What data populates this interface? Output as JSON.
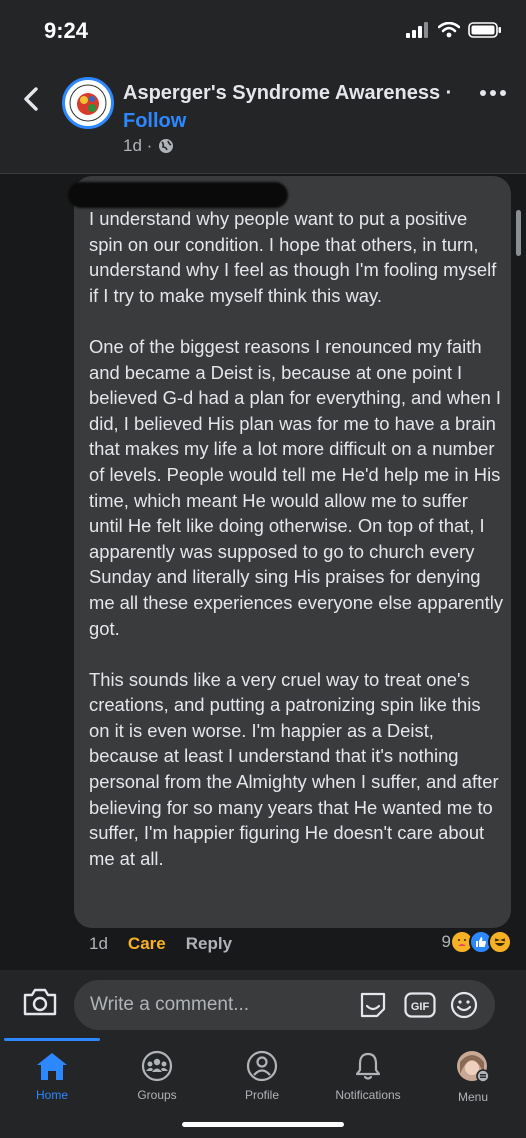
{
  "status": {
    "time": "9:24"
  },
  "header": {
    "page_name": "Asperger's Syndrome Awareness ·",
    "follow_label": "Follow",
    "timestamp": "1d ·"
  },
  "comment": {
    "paragraphs": [
      "I understand why people want to put a positive spin on our condition. I hope that others, in turn, understand why I feel as though I'm fooling myself if I try to make myself think this way.",
      "One of the biggest reasons I renounced my faith and became a Deist is, because at one point I believed G-d had a plan for everything, and when I did, I believed His plan was for me to have a brain that makes my life a lot more difficult on a number of levels. People would tell me He'd help me in His time, which meant He would allow me to suffer until He felt like doing otherwise. On top of that, I apparently was supposed to go to church every Sunday and literally sing His praises for denying me all these experiences everyone else apparently got.",
      "This sounds like a very cruel way to treat one's creations, and putting a patronizing spin like this on it is even worse. I'm happier as a Deist, because at least I understand that it's nothing personal from the Almighty when I suffer, and after believing for so many years that He wanted me to suffer, I'm happier figuring He doesn't care about me at all."
    ],
    "time": "1d",
    "care_label": "Care",
    "reply_label": "Reply",
    "reaction_count": "9"
  },
  "composer": {
    "placeholder": "Write a comment...",
    "gif_label": "GIF"
  },
  "tabs": [
    {
      "label": "Home"
    },
    {
      "label": "Groups"
    },
    {
      "label": "Profile"
    },
    {
      "label": "Notifications"
    },
    {
      "label": "Menu"
    }
  ],
  "colors": {
    "accent": "#2d88ff",
    "care": "#f7b125",
    "background": "#242526",
    "bubble": "#3a3b3c"
  }
}
